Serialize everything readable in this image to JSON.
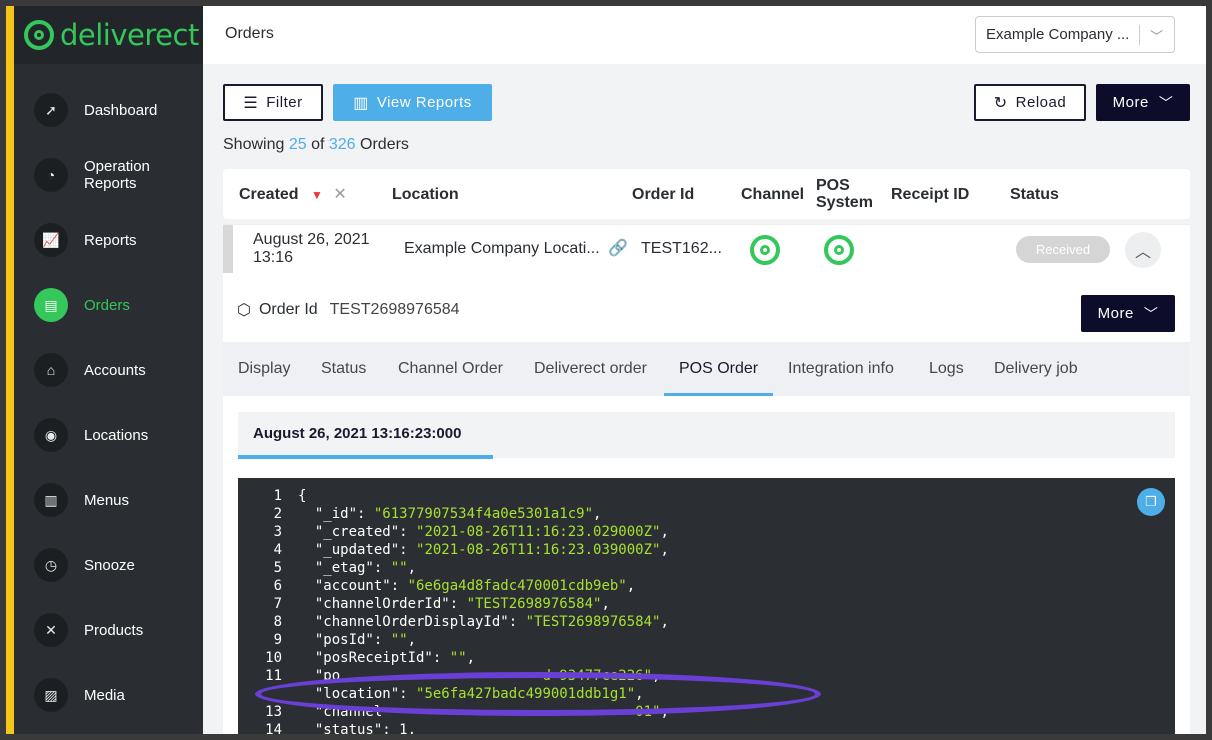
{
  "brand": {
    "name": "deliverect",
    "accent": "#34c759",
    "highlight": "#f5c518"
  },
  "sidebar": {
    "items": [
      {
        "label": "Dashboard",
        "icon": "rocket-icon",
        "glyph": "➚"
      },
      {
        "label": "Operation Reports",
        "icon": "gauge-icon",
        "glyph": "◔"
      },
      {
        "label": "Reports",
        "icon": "chart-line-icon",
        "glyph": "📈"
      },
      {
        "label": "Orders",
        "icon": "document-icon",
        "glyph": "▤",
        "active": true
      },
      {
        "label": "Accounts",
        "icon": "store-icon",
        "glyph": "⌂"
      },
      {
        "label": "Locations",
        "icon": "map-pin-icon",
        "glyph": "◉"
      },
      {
        "label": "Menus",
        "icon": "book-icon",
        "glyph": "▥"
      },
      {
        "label": "Snooze",
        "icon": "alarm-clock-icon",
        "glyph": "◷"
      },
      {
        "label": "Products",
        "icon": "utensils-icon",
        "glyph": "✕"
      },
      {
        "label": "Media",
        "icon": "image-icon",
        "glyph": "▨"
      }
    ]
  },
  "header": {
    "title": "Orders",
    "company_select": "Example Company ..."
  },
  "toolbar": {
    "filter": "Filter",
    "view_reports": "View Reports",
    "reload": "Reload",
    "more": "More"
  },
  "showing": {
    "prefix": "Showing",
    "shown": "25",
    "of": "of",
    "total": "326",
    "suffix": "Orders"
  },
  "table": {
    "headers": {
      "created": "Created",
      "location": "Location",
      "order_id": "Order Id",
      "channel": "Channel",
      "pos_line1": "POS",
      "pos_line2": "System",
      "receipt": "Receipt ID",
      "status": "Status"
    },
    "row": {
      "created_date": "August 26, 2021",
      "created_time": "13:16",
      "location": "Example Company Locati...",
      "order_id": "TEST162...",
      "status": "Received"
    }
  },
  "detail": {
    "order_id_label": "Order Id",
    "order_id_value": "TEST2698976584",
    "more": "More",
    "tabs": [
      "Display",
      "Status",
      "Channel Order",
      "Deliverect order",
      "POS Order",
      "Integration info",
      "Logs",
      "Delivery job"
    ],
    "active_tab": "POS Order",
    "timestamp": "August 26, 2021 13:16:23:000"
  },
  "code_lines": [
    {
      "n": "1",
      "k": "{",
      "v": "",
      "t": ""
    },
    {
      "n": "2",
      "k": "  \"_id\": ",
      "v": "\"61377907534f4a0e5301a1c9\"",
      "t": ","
    },
    {
      "n": "3",
      "k": "  \"_created\": ",
      "v": "\"2021-08-26T11:16:23.029000Z\"",
      "t": ","
    },
    {
      "n": "4",
      "k": "  \"_updated\": ",
      "v": "\"2021-08-26T11:16:23.039000Z\"",
      "t": ","
    },
    {
      "n": "5",
      "k": "  \"_etag\": ",
      "v": "\"\"",
      "t": ","
    },
    {
      "n": "6",
      "k": "  \"account\": ",
      "v": "\"6e6ga4d8fadc470001cdb9eb\"",
      "t": ","
    },
    {
      "n": "7",
      "k": "  \"channelOrderId\": ",
      "v": "\"TEST2698976584\"",
      "t": ","
    },
    {
      "n": "8",
      "k": "  \"channelOrderDisplayId\": ",
      "v": "\"TEST2698976584\"",
      "t": ","
    },
    {
      "n": "9",
      "k": "  \"posId\": ",
      "v": "\"\"",
      "t": ","
    },
    {
      "n": "10",
      "k": "  \"posReceiptId\": ",
      "v": "\"\"",
      "t": ","
    },
    {
      "n": "11",
      "k": "  \"po",
      "v": "                        d 93477ce226\"",
      "t": ","
    },
    {
      "n": "",
      "k": "  \"location\": ",
      "v": "\"5e6fa427badc499001ddb1g1\"",
      "t": ","
    },
    {
      "n": "13",
      "k": "  \"channel",
      "v": "                              01\"",
      "t": ","
    },
    {
      "n": "14",
      "k": "  \"status\": 1,",
      "v": "",
      "t": ""
    }
  ],
  "annotation_color": "#6a3fd6"
}
